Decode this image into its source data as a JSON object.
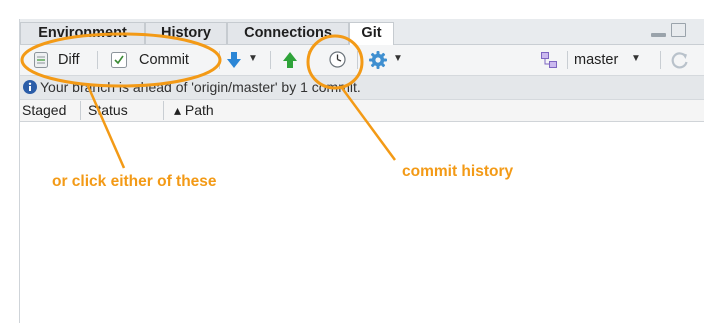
{
  "tabs": [
    {
      "label": "Environment"
    },
    {
      "label": "History"
    },
    {
      "label": "Connections"
    },
    {
      "label": "Git",
      "active": true
    }
  ],
  "toolbar": {
    "diff_label": "Diff",
    "commit_label": "Commit",
    "pull_icon": "pull-arrow-down-icon",
    "push_icon": "push-arrow-up-icon",
    "history_icon": "clock-icon",
    "more_icon": "gear-icon",
    "branch_label": "master",
    "refresh_icon": "refresh-icon"
  },
  "info": {
    "message": "Your branch is ahead of 'origin/master' by 1 commit."
  },
  "columns": [
    {
      "label": "Staged"
    },
    {
      "label": "Status"
    },
    {
      "label": "▴ Path"
    }
  ],
  "annotations": {
    "left_callout": "or click either of these",
    "right_callout": "commit history"
  },
  "colors": {
    "annotation": "#f39a16",
    "info_icon": "#2b5da8",
    "pull_blue": "#2b86d6",
    "push_green": "#2fa33a"
  }
}
